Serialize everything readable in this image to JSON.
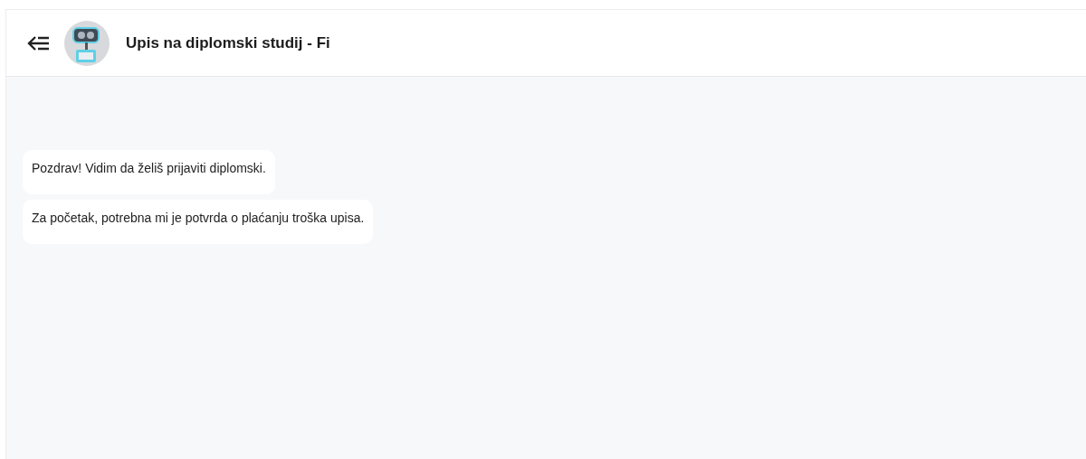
{
  "header": {
    "title": "Upis na diplomski studij - Fi"
  },
  "messages": [
    {
      "text": "Pozdrav! Vidim da želiš prijaviti diplomski."
    },
    {
      "text": "Za početak, potrebna mi je potvrda o plaćanju troška upisa."
    }
  ]
}
